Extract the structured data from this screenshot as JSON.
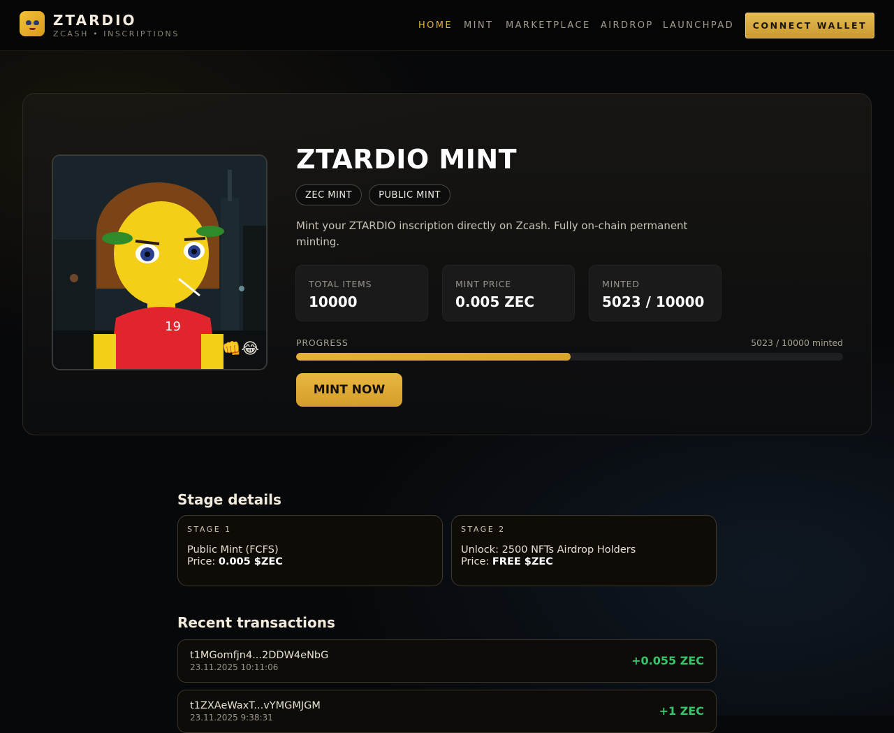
{
  "header": {
    "brand_title": "ZTARDIO",
    "brand_subtitle": "ZCASH • INSCRIPTIONS",
    "nav": [
      {
        "label": "HOME",
        "active": true
      },
      {
        "label": "MINT",
        "active": false
      },
      {
        "label": "MARKETPLACE",
        "active": false
      },
      {
        "label": "AIRDROP",
        "active": false
      },
      {
        "label": "LAUNCHPAD",
        "active": false
      }
    ],
    "connect_label": "CONNECT WALLET"
  },
  "hero": {
    "title": "ZTARDIO MINT",
    "pills": [
      "ZEC MINT",
      "PUBLIC MINT"
    ],
    "description": "Mint your ZTARDIO inscription directly on Zcash. Fully on-chain permanent minting.",
    "art_emoji": "👊😂",
    "stats": [
      {
        "label": "TOTAL ITEMS",
        "value": "10000"
      },
      {
        "label": "MINT PRICE",
        "value": "0.005 ZEC"
      },
      {
        "label": "MINTED",
        "value": "5023 / 10000"
      }
    ],
    "progress": {
      "label": "PROGRESS",
      "text": "5023 / 10000 minted",
      "fraction": 0.5023
    },
    "mint_label": "MINT NOW"
  },
  "stages": {
    "title": "Stage details",
    "items": [
      {
        "tag": "STAGE 1",
        "line1": "Public Mint (FCFS)",
        "price_label": "Price: ",
        "price": "0.005 $ZEC"
      },
      {
        "tag": "STAGE 2",
        "line1": "Unlock: 2500 NFTs Airdrop Holders",
        "price_label": "Price: ",
        "price": "FREE $ZEC"
      }
    ]
  },
  "transactions": {
    "title": "Recent transactions",
    "items": [
      {
        "address": "t1MGomfjn4...2DDW4eNbG",
        "time": "23.11.2025 10:11:06",
        "amount": "+0.055 ZEC"
      },
      {
        "address": "t1ZXAeWaxT...vYMGMJGM",
        "time": "23.11.2025 9:38:31",
        "amount": "+1 ZEC"
      }
    ]
  },
  "colors": {
    "accent": "#e6b53b",
    "positive": "#37c56a",
    "background": "#07080a"
  }
}
